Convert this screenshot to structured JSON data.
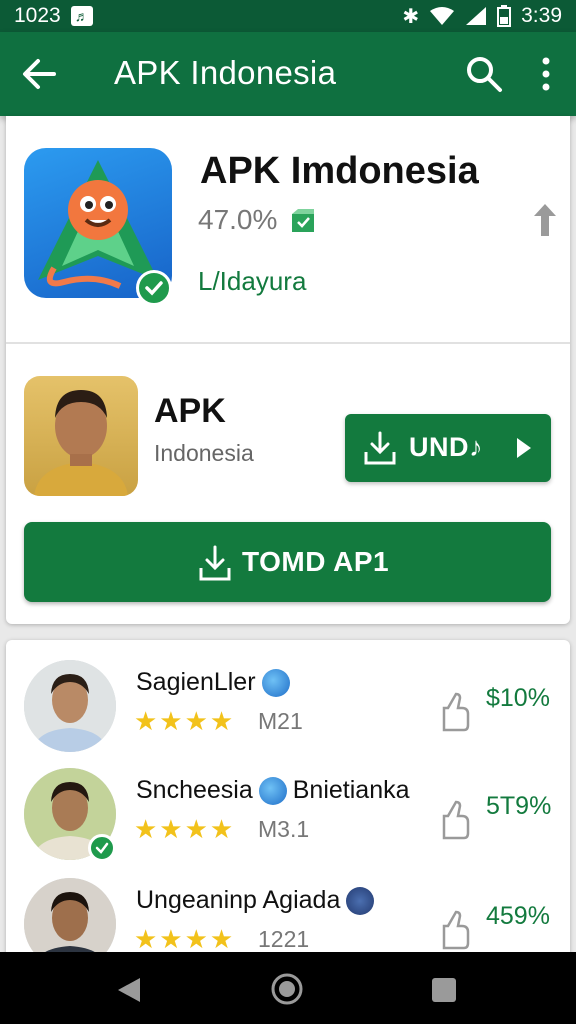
{
  "status_bar": {
    "left_number": "1023",
    "notif_glyph": "♬",
    "time": "3:39"
  },
  "app_bar": {
    "title": "APK Indonesia",
    "icons": [
      "back-arrow-icon",
      "search-icon",
      "more-vert-icon"
    ]
  },
  "app_card": {
    "name": "APK Imdonesia",
    "percent": "47.0%",
    "developer": "L/Idayura",
    "icons": [
      "app-icon",
      "verified-check-icon",
      "box-icon",
      "upload-arrow-icon"
    ]
  },
  "feature": {
    "title": "APK",
    "subtitle": "Indonesia",
    "small_button_label": "UND♪",
    "main_button_label": "TOMD AP1"
  },
  "reviews": [
    {
      "name": "SagienLler",
      "count": "M21",
      "percent": "$10%",
      "stars": "★★★★",
      "verified": false
    },
    {
      "name": "Sncheesia",
      "name_suffix": "Bnietianka",
      "count": "M3.1",
      "percent": "5T9%",
      "stars": "★★★★",
      "verified": true
    },
    {
      "name": "Ungeaninp Agiada",
      "count": "1221",
      "percent": "459%",
      "stars": "★★★★",
      "verified": false
    }
  ],
  "colors": {
    "primary": "#0f7040",
    "status_bar": "#0c5a36",
    "accent_text": "#137a3e",
    "star": "#f2c21b"
  }
}
